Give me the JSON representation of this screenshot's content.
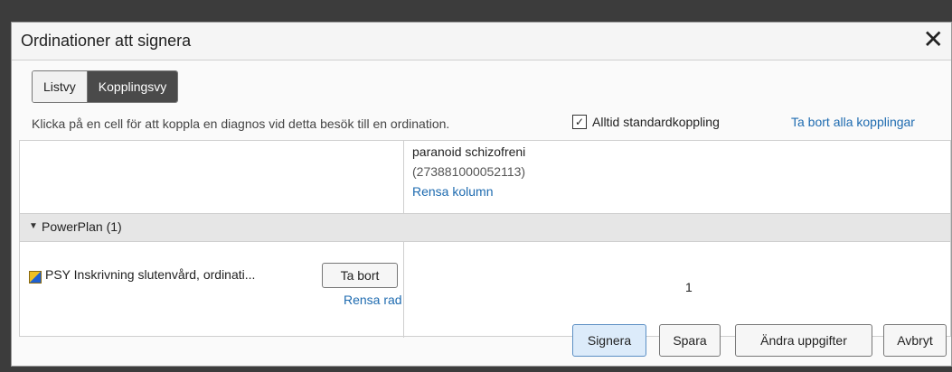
{
  "dialog": {
    "title": "Ordinationer att signera",
    "close_glyph": "✕"
  },
  "view_toggle": {
    "list_label": "Listvy",
    "link_label": "Kopplingsvy",
    "active": "Kopplingsvy"
  },
  "instruction_text": "Klicka på en cell för att koppla en diagnos vid detta besök till en ordination.",
  "always_standard": {
    "checked": true,
    "check_glyph": "✓",
    "label": "Alltid standardkoppling"
  },
  "remove_all_link": "Ta bort alla kopplingar",
  "grid": {
    "diagnosis": {
      "name": "paranoid schizofreni",
      "code": "(273881000052113)",
      "clear_column": "Rensa kolumn"
    },
    "group": {
      "caret": "▼",
      "label": "PowerPlan (1)"
    },
    "order": {
      "icon": "powerplan-icon",
      "text": "PSY Inskrivning slutenvård, ordinati...",
      "remove_button": "Ta bort",
      "clear_row": "Rensa rad",
      "cell_value": "1"
    }
  },
  "footer": {
    "sign": "Signera",
    "save": "Spara",
    "edit": "Ändra uppgifter",
    "cancel": "Avbryt"
  }
}
